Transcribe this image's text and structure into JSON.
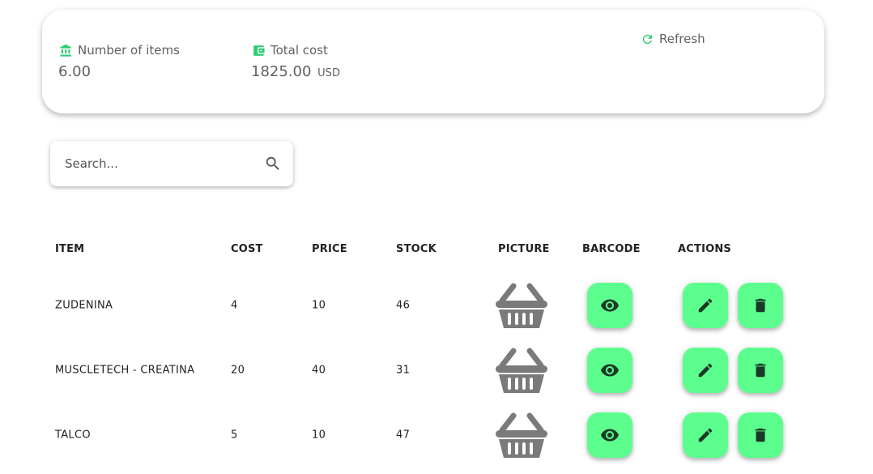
{
  "summary": {
    "items_label": "Number of items",
    "items_value": "6.00",
    "cost_label": "Total cost",
    "cost_value": "1825.00",
    "cost_unit": "USD",
    "refresh_label": "Refresh"
  },
  "search": {
    "placeholder": "Search..."
  },
  "table": {
    "headers": {
      "item": "ITEM",
      "cost": "COST",
      "price": "PRICE",
      "stock": "STOCK",
      "picture": "PICTURE",
      "barcode": "BARCODE",
      "actions": "ACTIONS"
    },
    "rows": [
      {
        "item": "ZUDENINA",
        "cost": "4",
        "price": "10",
        "stock": "46"
      },
      {
        "item": "MUSCLETECH - CREATINA",
        "cost": "20",
        "price": "40",
        "stock": "31"
      },
      {
        "item": "TALCO",
        "cost": "5",
        "price": "10",
        "stock": "47"
      }
    ]
  },
  "colors": {
    "accent": "#2ecc71",
    "button_bg": "#5cff8e",
    "button_icon": "#1b3a26",
    "basket": "#7a7a7a"
  },
  "icons": {
    "items": "bank-icon",
    "cost": "wallet-icon",
    "refresh": "refresh-icon",
    "search": "search-icon",
    "picture": "basket-icon",
    "barcode": "eye-icon",
    "edit": "pencil-icon",
    "delete": "trash-icon"
  }
}
